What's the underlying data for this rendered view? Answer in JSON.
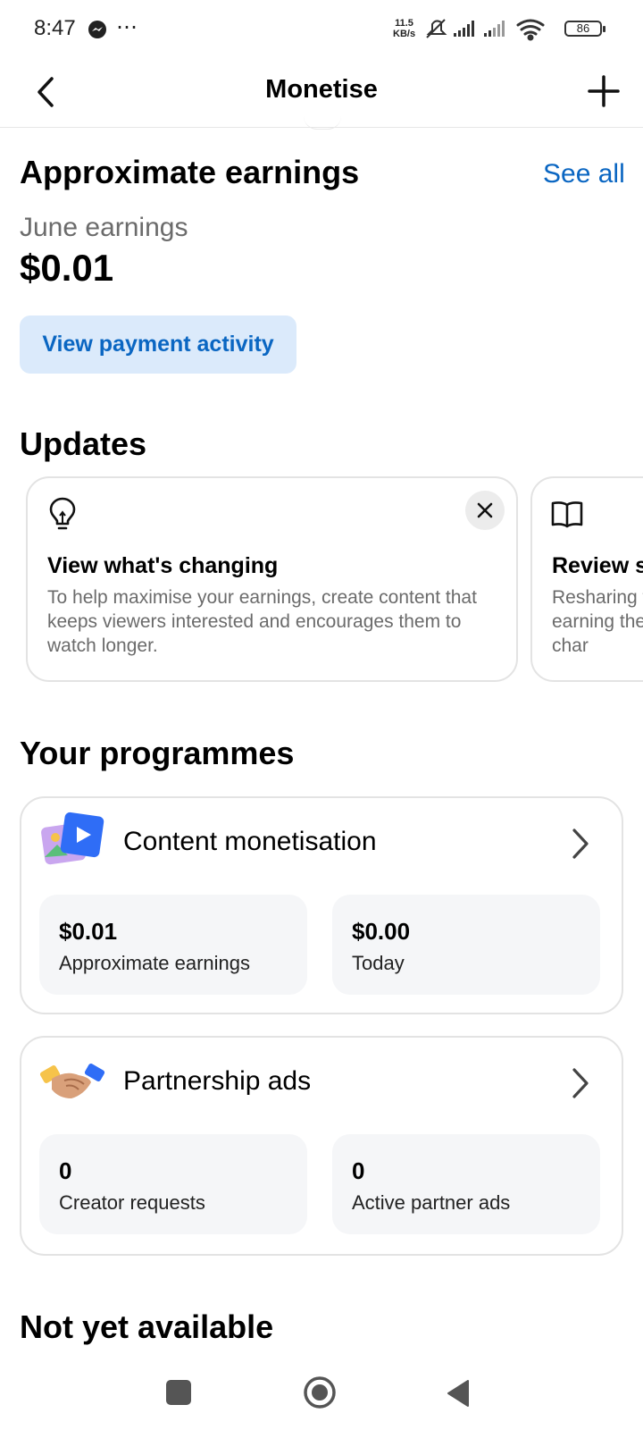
{
  "status_bar": {
    "time": "8:47",
    "speed_value": "11.5",
    "speed_unit": "KB/s",
    "battery": "86"
  },
  "header": {
    "title": "Monetise"
  },
  "earnings": {
    "heading": "Approximate earnings",
    "see_all": "See all",
    "period_label": "June earnings",
    "amount": "$0.01",
    "payment_button": "View payment activity"
  },
  "updates": {
    "heading": "Updates",
    "cards": [
      {
        "title": "View what's changing",
        "body": "To help maximise your earnings, create content that keeps viewers interested and encourages them to watch longer."
      },
      {
        "title": "Review s",
        "body": "Resharing for earning these char"
      }
    ]
  },
  "programmes": {
    "heading": "Your programmes",
    "items": [
      {
        "title": "Content monetisation",
        "stats": [
          {
            "value": "$0.01",
            "label": "Approximate earnings"
          },
          {
            "value": "$0.00",
            "label": "Today"
          }
        ]
      },
      {
        "title": "Partnership ads",
        "stats": [
          {
            "value": "0",
            "label": "Creator requests"
          },
          {
            "value": "0",
            "label": "Active partner ads"
          }
        ]
      }
    ]
  },
  "not_yet_available": {
    "heading": "Not yet available"
  },
  "colors": {
    "accent": "#0a66c2",
    "button_bg": "#dbeafb",
    "stat_bg": "#f5f6f8",
    "border": "#e3e3e3"
  },
  "icons": [
    "messenger-icon",
    "more-dots-icon",
    "mute-icon",
    "signal-icon",
    "wifi-icon",
    "battery-icon",
    "back-arrow-icon",
    "plus-icon",
    "lightbulb-icon",
    "close-icon",
    "book-icon",
    "content-monetisation-icon",
    "handshake-icon",
    "chevron-right-icon",
    "nav-recents-icon",
    "nav-home-icon",
    "nav-back-icon"
  ]
}
